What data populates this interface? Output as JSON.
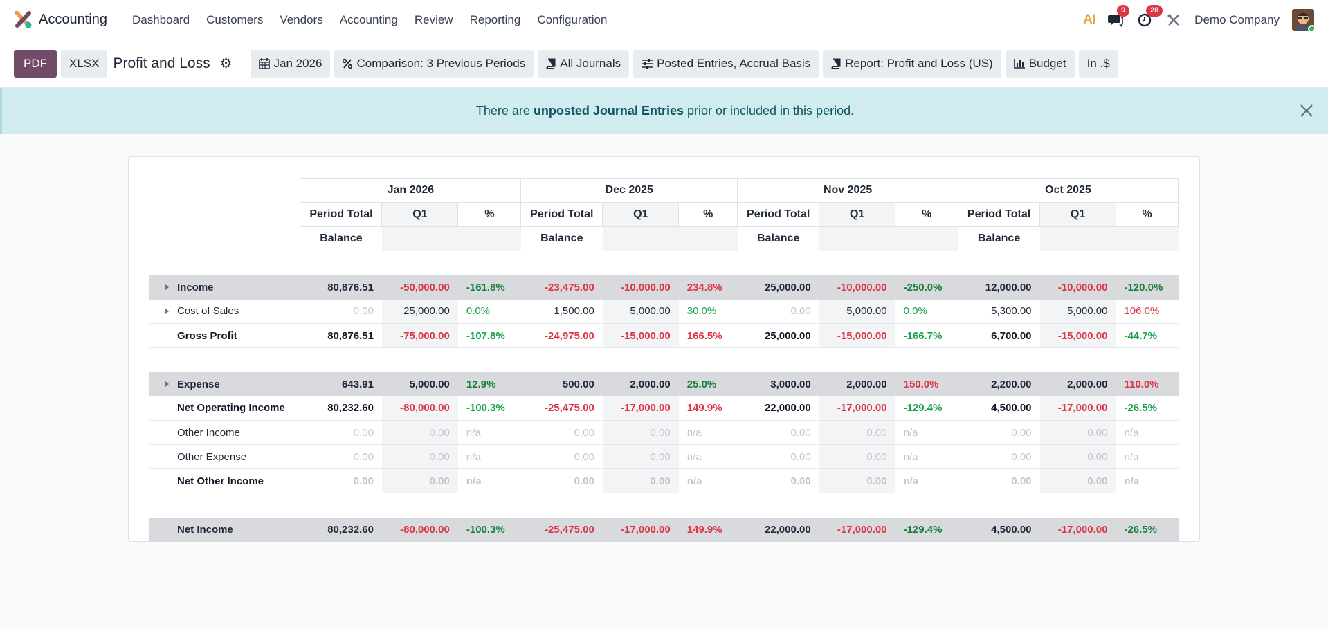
{
  "nav": {
    "app_name": "Accounting",
    "menu": [
      "Dashboard",
      "Customers",
      "Vendors",
      "Accounting",
      "Review",
      "Reporting",
      "Configuration"
    ],
    "ai_label": "AI",
    "messages_badge": "9",
    "activities_badge": "28",
    "company": "Demo Company"
  },
  "toolbar": {
    "pdf_label": "PDF",
    "xlsx_label": "XLSX",
    "report_title": "Profit and Loss",
    "filters": {
      "date": "Jan 2026",
      "comparison": "Comparison: 3 Previous Periods",
      "journals": "All Journals",
      "entries": "Posted Entries, Accrual Basis",
      "report": "Report: Profit and Loss (US)",
      "budget": "Budget",
      "rounding": "In .$"
    }
  },
  "alert": {
    "prefix": "There are ",
    "link": "unposted Journal Entries",
    "suffix": " prior or included in this period."
  },
  "table": {
    "periods": [
      "Jan 2026",
      "Dec 2025",
      "Nov 2025",
      "Oct 2025"
    ],
    "col_headers": [
      "Period Total",
      "Q1",
      "%"
    ],
    "balance_label": "Balance",
    "rows": [
      {
        "label": "Income",
        "cells": [
          [
            "80,876.51",
            "-50,000.00",
            "-161.8%"
          ],
          [
            "-23,475.00",
            "-10,000.00",
            "234.8%"
          ],
          [
            "25,000.00",
            "-10,000.00",
            "-250.0%"
          ],
          [
            "12,000.00",
            "-10,000.00",
            "-120.0%"
          ]
        ]
      },
      {
        "label": "Cost of Sales",
        "cells": [
          [
            "0.00",
            "25,000.00",
            "0.0%"
          ],
          [
            "1,500.00",
            "5,000.00",
            "30.0%"
          ],
          [
            "0.00",
            "5,000.00",
            "0.0%"
          ],
          [
            "5,300.00",
            "5,000.00",
            "106.0%"
          ]
        ]
      },
      {
        "label": "Gross Profit",
        "cells": [
          [
            "80,876.51",
            "-75,000.00",
            "-107.8%"
          ],
          [
            "-24,975.00",
            "-15,000.00",
            "166.5%"
          ],
          [
            "25,000.00",
            "-15,000.00",
            "-166.7%"
          ],
          [
            "6,700.00",
            "-15,000.00",
            "-44.7%"
          ]
        ]
      },
      {
        "label": "Expense",
        "cells": [
          [
            "643.91",
            "5,000.00",
            "12.9%"
          ],
          [
            "500.00",
            "2,000.00",
            "25.0%"
          ],
          [
            "3,000.00",
            "2,000.00",
            "150.0%"
          ],
          [
            "2,200.00",
            "2,000.00",
            "110.0%"
          ]
        ]
      },
      {
        "label": "Net Operating Income",
        "cells": [
          [
            "80,232.60",
            "-80,000.00",
            "-100.3%"
          ],
          [
            "-25,475.00",
            "-17,000.00",
            "149.9%"
          ],
          [
            "22,000.00",
            "-17,000.00",
            "-129.4%"
          ],
          [
            "4,500.00",
            "-17,000.00",
            "-26.5%"
          ]
        ]
      },
      {
        "label": "Other Income",
        "cells": [
          [
            "0.00",
            "0.00",
            "n/a"
          ],
          [
            "0.00",
            "0.00",
            "n/a"
          ],
          [
            "0.00",
            "0.00",
            "n/a"
          ],
          [
            "0.00",
            "0.00",
            "n/a"
          ]
        ]
      },
      {
        "label": "Other Expense",
        "cells": [
          [
            "0.00",
            "0.00",
            "n/a"
          ],
          [
            "0.00",
            "0.00",
            "n/a"
          ],
          [
            "0.00",
            "0.00",
            "n/a"
          ],
          [
            "0.00",
            "0.00",
            "n/a"
          ]
        ]
      },
      {
        "label": "Net Other Income",
        "cells": [
          [
            "0.00",
            "0.00",
            "n/a"
          ],
          [
            "0.00",
            "0.00",
            "n/a"
          ],
          [
            "0.00",
            "0.00",
            "n/a"
          ],
          [
            "0.00",
            "0.00",
            "n/a"
          ]
        ]
      },
      {
        "label": "Net Income",
        "cells": [
          [
            "80,232.60",
            "-80,000.00",
            "-100.3%"
          ],
          [
            "-25,475.00",
            "-17,000.00",
            "149.9%"
          ],
          [
            "22,000.00",
            "-17,000.00",
            "-129.4%"
          ],
          [
            "4,500.00",
            "-17,000.00",
            "-26.5%"
          ]
        ]
      }
    ]
  },
  "colors": {
    "brand": "#714b67",
    "negative": "#dc3545",
    "positive": "#16a34a",
    "alert_bg": "#d1ecf1",
    "section_bg": "#d8dadd"
  }
}
